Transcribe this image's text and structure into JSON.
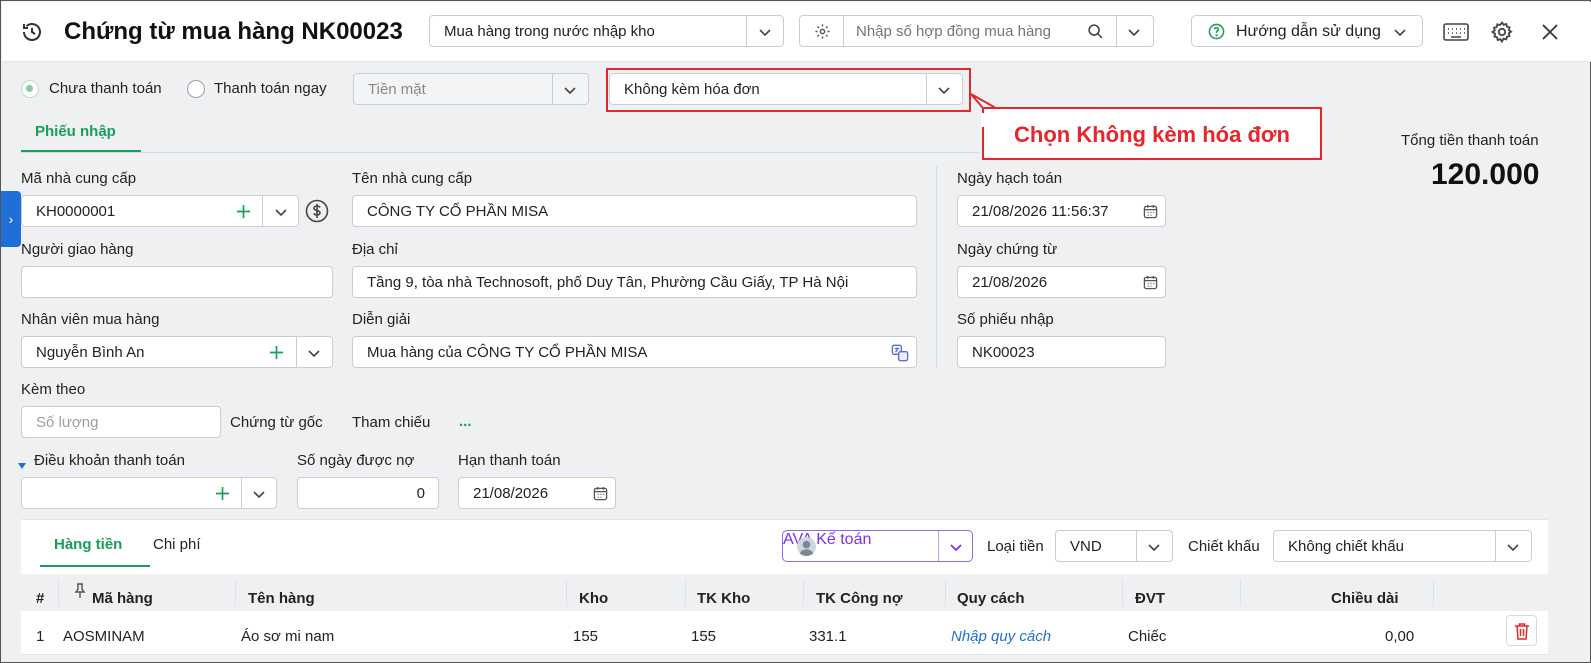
{
  "header": {
    "title": "Chứng từ mua hàng NK00023",
    "purchase_type": "Mua hàng trong nước nhập kho",
    "contract_placeholder": "Nhập số hợp đồng mua hàng",
    "help_label": "Hướng dẫn sử dụng"
  },
  "payment": {
    "unpaid_label": "Chưa thanh toán",
    "pay_now_label": "Thanh toán ngay",
    "method": "Tiền mặt",
    "invoice_option": "Không kèm hóa đơn"
  },
  "callout": {
    "text": "Chọn Không kèm hóa đơn"
  },
  "tabs": {
    "receipt": "Phiếu nhập"
  },
  "total": {
    "label": "Tổng tiền thanh toán",
    "value": "120.000"
  },
  "form": {
    "supplier_code_label": "Mã nhà cung cấp",
    "supplier_code": "KH0000001",
    "supplier_name_label": "Tên nhà cung cấp",
    "supplier_name": "CÔNG TY CỔ PHẦN MISA",
    "deliverer_label": "Người giao hàng",
    "deliverer": "",
    "address_label": "Địa chỉ",
    "address": "Tầng 9, tòa nhà Technosoft, phố Duy Tân, Phường Cầu Giấy, TP Hà Nội",
    "buyer_label": "Nhân viên mua hàng",
    "buyer": "Nguyễn Bình An",
    "description_label": "Diễn giải",
    "description": "Mua hàng của CÔNG TY CỔ PHẦN MISA",
    "attach_label": "Kèm theo",
    "qty_placeholder": "Số lượng",
    "original_doc_label": "Chứng từ gốc",
    "reference_label": "Tham chiếu",
    "reference_more": "...",
    "posting_date_label": "Ngày hạch toán",
    "posting_date": "21/08/2026 11:56:37",
    "doc_date_label": "Ngày chứng từ",
    "doc_date": "21/08/2026",
    "receipt_no_label": "Số phiếu nhập",
    "receipt_no": "NK00023",
    "payment_terms_label": "Điều khoản thanh toán",
    "payment_terms": "",
    "credit_days_label": "Số ngày được nợ",
    "credit_days": "0",
    "due_date_label": "Hạn thanh toán",
    "due_date": "21/08/2026"
  },
  "detail": {
    "tab_goods": "Hàng tiền",
    "tab_costs": "Chi phí",
    "ava_label": "AVA Kế toán",
    "currency_label": "Loại tiền",
    "currency": "VND",
    "discount_label": "Chiết khấu",
    "discount": "Không chiết khấu",
    "columns": [
      "#",
      "Mã hàng",
      "Tên hàng",
      "Kho",
      "TK Kho",
      "TK Công nợ",
      "Quy cách",
      "ĐVT",
      "Chiều dài"
    ],
    "rows": [
      {
        "no": "1",
        "code": "AOSMINAM",
        "name": "Áo sơ mi nam",
        "warehouse": "155",
        "inv_account": "155",
        "payable_account": "331.1",
        "spec": "Nhập quy cách",
        "unit": "Chiếc",
        "length": "0,00"
      }
    ]
  },
  "colors": {
    "accent": "#1a9e5b",
    "callout": "#e6262a",
    "ava": "#7b2ff7"
  }
}
